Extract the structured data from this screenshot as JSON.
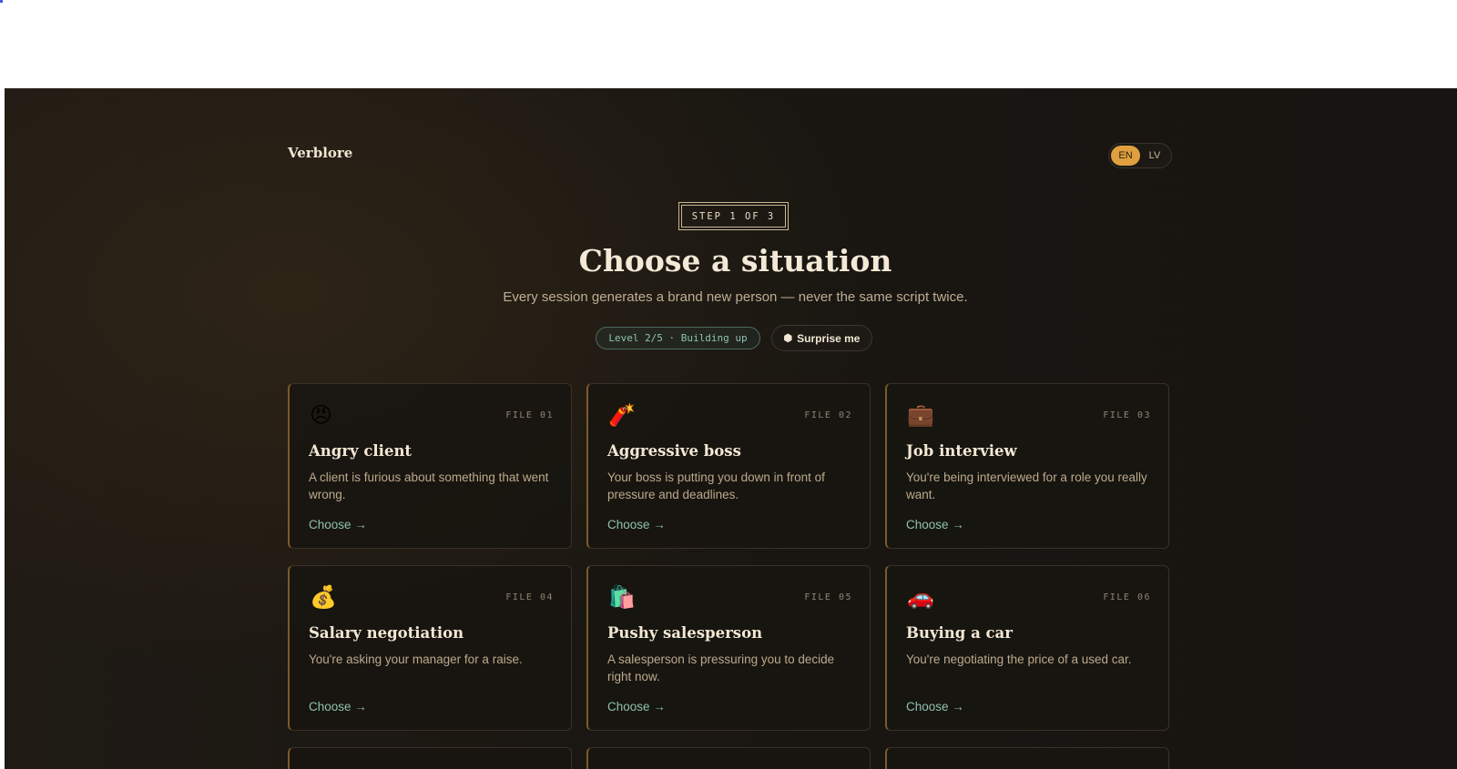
{
  "app": {
    "brand": "Verblore"
  },
  "language": {
    "options": [
      "EN",
      "LV"
    ],
    "selected": "EN"
  },
  "step": {
    "label": "STEP 1 OF 3"
  },
  "hero": {
    "title": "Choose a situation",
    "subtitle": "Every session generates a brand new person — never the same script twice."
  },
  "level": {
    "label": "Level 2/5 · Building up"
  },
  "surprise": {
    "icon": "dice-icon",
    "label": "Surprise me"
  },
  "colors": {
    "accent": "#e0a040",
    "teal": "#8fc1ae",
    "background": "#1a1712"
  },
  "cards": [
    {
      "icon": "😠",
      "icon_name": "angry-face-icon",
      "file": "FILE 01",
      "title": "Angry client",
      "description": "A client is furious about something that went wrong.",
      "cta": "Choose →"
    },
    {
      "icon": "🧨",
      "icon_name": "firecracker-icon",
      "file": "FILE 02",
      "title": "Aggressive boss",
      "description": "Your boss is putting you down in front of pressure and deadlines.",
      "cta": "Choose →"
    },
    {
      "icon": "💼",
      "icon_name": "briefcase-icon",
      "file": "FILE 03",
      "title": "Job interview",
      "description": "You're being interviewed for a role you really want.",
      "cta": "Choose →"
    },
    {
      "icon": "💰",
      "icon_name": "money-bag-icon",
      "file": "FILE 04",
      "title": "Salary negotiation",
      "description": "You're asking your manager for a raise.",
      "cta": "Choose →"
    },
    {
      "icon": "🛍️",
      "icon_name": "shopping-bags-icon",
      "file": "FILE 05",
      "title": "Pushy salesperson",
      "description": "A salesperson is pressuring you to decide right now.",
      "cta": "Choose →"
    },
    {
      "icon": "🚗",
      "icon_name": "car-icon",
      "file": "FILE 06",
      "title": "Buying a car",
      "description": "You're negotiating the price of a used car.",
      "cta": "Choose →"
    }
  ]
}
